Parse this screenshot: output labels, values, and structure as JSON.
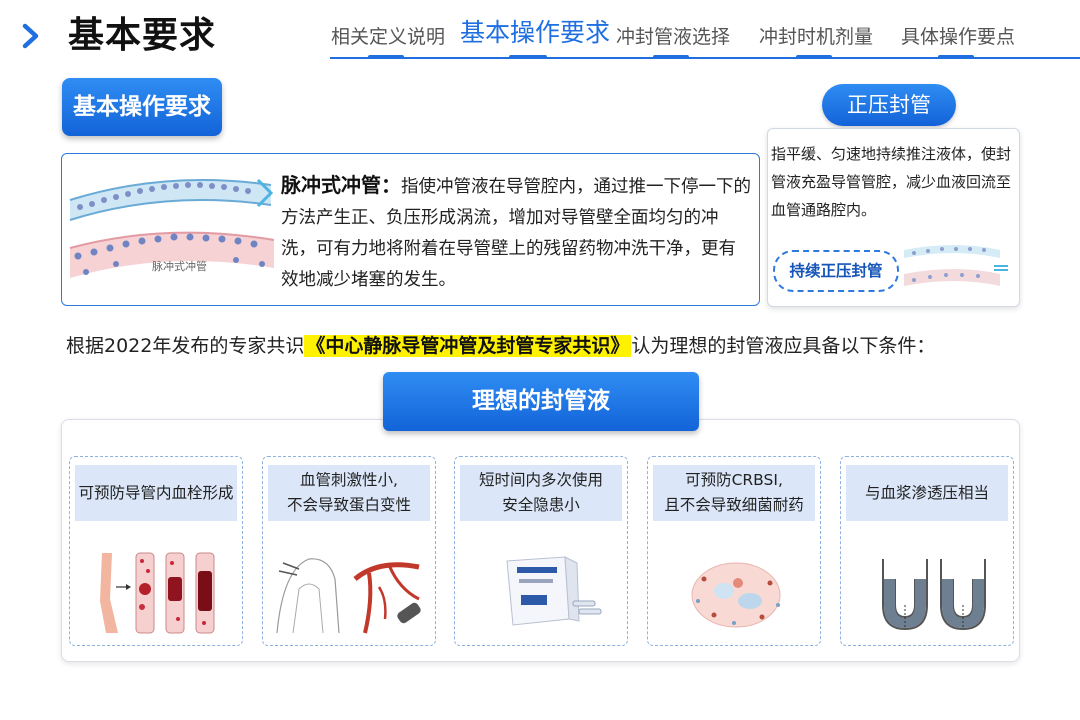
{
  "header": {
    "title": "基本要求",
    "nav": [
      {
        "label": "相关定义说明",
        "active": false
      },
      {
        "label": "基本操作要求",
        "active": true
      },
      {
        "label": "冲封管液选择",
        "active": false
      },
      {
        "label": "冲封时机剂量",
        "active": false
      },
      {
        "label": "具体操作要点",
        "active": false
      }
    ]
  },
  "section": {
    "badge": "基本操作要求"
  },
  "pulse": {
    "heading": "脉冲式冲管：",
    "body": "指使冲管液在导管腔内，通过推一下停一下的方法产生正、负压形成涡流，增加对导管壁全面均匀的冲洗，可有力地将附着在导管壁上的残留药物冲洗干净，更有效地减少堵塞的发生。",
    "image_caption": "脉冲式冲管"
  },
  "positive_pressure": {
    "pill": "正压封管",
    "body": "指平缓、匀速地持续推注液体，使封管液充盈导管管腔，减少血液回流至血管通路腔内。",
    "tag": "持续正压封管"
  },
  "consensus": {
    "before": "根据2022年发布的专家共识",
    "highlight": "《中心静脉导管冲管及封管专家共识》",
    "after": "认为理想的封管液应具备以下条件："
  },
  "ideal": {
    "title": "理想的封管液",
    "cards": [
      {
        "line1": "可预防导管内血栓形成",
        "line2": "",
        "icon": "blood-clot-veins-icon"
      },
      {
        "line1": "血管刺激性小,",
        "line2": "不会导致蛋白变性",
        "icon": "vessel-catheter-icon"
      },
      {
        "line1": "短时间内多次使用",
        "line2": "安全隐患小",
        "icon": "prefilled-syringe-box-icon"
      },
      {
        "line1": "可预防CRBSI,",
        "line2": "且不会导致细菌耐药",
        "icon": "bacteria-cell-icon"
      },
      {
        "line1": "与血浆渗透压相当",
        "line2": "",
        "icon": "u-tube-osmosis-icon"
      }
    ]
  },
  "colors": {
    "accent": "#1f6fe0",
    "highlight": "#fff200",
    "label_bg": "#dbe6f8"
  }
}
